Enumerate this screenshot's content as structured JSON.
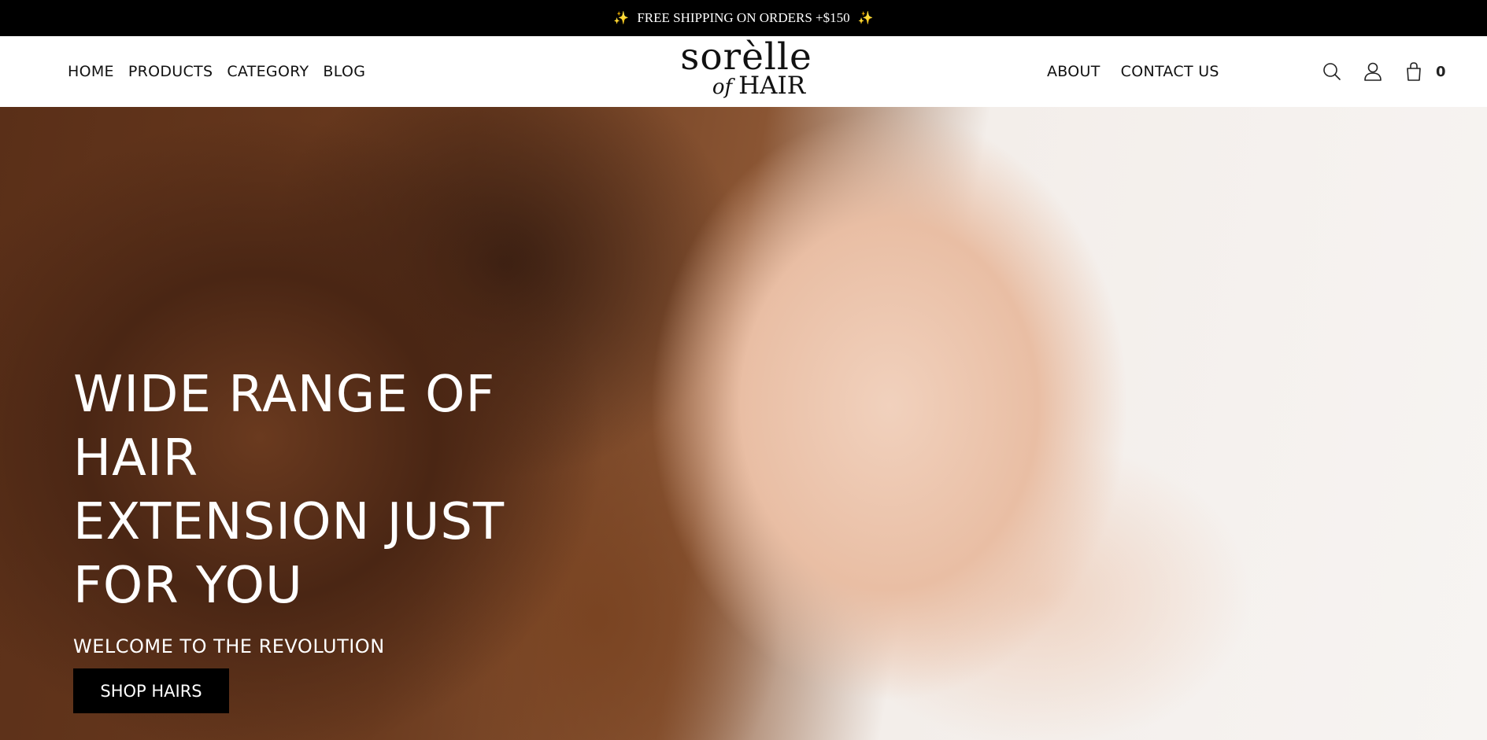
{
  "announcement": {
    "sparkle_left": "✨",
    "text": "FREE SHIPPING ON ORDERS +$150",
    "sparkle_right": "✨"
  },
  "nav": {
    "left": [
      {
        "label": "HOME"
      },
      {
        "label": "PRODUCTS"
      },
      {
        "label": "CATEGORY"
      },
      {
        "label": "BLOG"
      }
    ],
    "right": [
      {
        "label": "ABOUT"
      },
      {
        "label": "CONTACT US"
      }
    ]
  },
  "logo": {
    "main": "sorèlle",
    "of": "of",
    "sub": "HAIR"
  },
  "icons": {
    "search": "search-icon",
    "account": "user-icon",
    "cart": "shopping-bag-icon",
    "cart_count": "0"
  },
  "hero": {
    "heading": "WIDE RANGE OF HAIR\nEXTENSION JUST\nFOR YOU",
    "subtitle": "WELCOME TO THE REVOLUTION",
    "button_label": "SHOP HAIRS"
  },
  "colors": {
    "announcement_bg": "#000000",
    "header_bg": "#ffffff",
    "button_bg": "#000000",
    "sparkle": "#f4d35e"
  }
}
